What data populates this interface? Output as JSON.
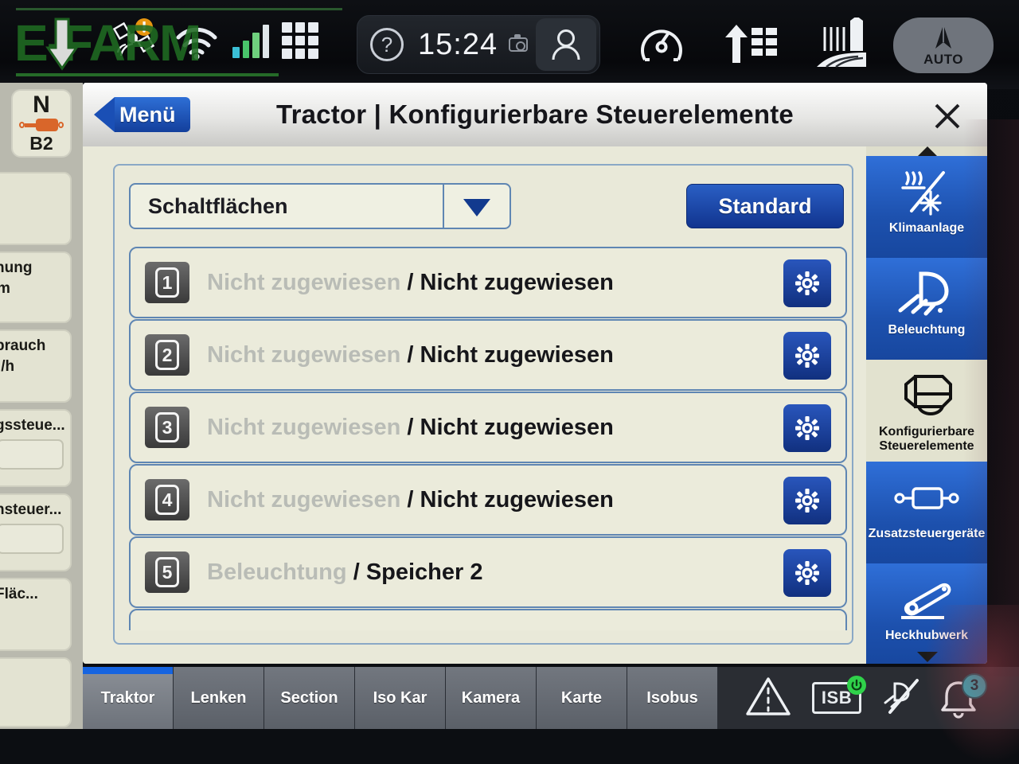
{
  "topbar": {
    "time": "15:24",
    "help_icon": "help-circle-icon",
    "camera_icon": "camera-icon",
    "user_icon": "user-icon",
    "gauge_icon": "performance-gauge-icon",
    "transfer_icon": "data-transfer-icon",
    "farm_icon": "farm-field-icon",
    "auto_label": "AUTO",
    "auto_icon": "steering-auto-icon",
    "satellite_icon": "satellite-warning-icon",
    "wifi_icon": "wifi-icon",
    "signal_icon": "signal-bars-icon",
    "apps_icon": "apps-grid-icon",
    "watermark": "E-FARM"
  },
  "left_widgets": [
    {
      "name": "gear-indicator",
      "gear": "N",
      "range": "B2"
    },
    {
      "name": "blank-widget",
      "title": "",
      "unit": ""
    },
    {
      "name": "speed-widget",
      "title": "hung",
      "unit": "m"
    },
    {
      "name": "consumption-widget",
      "title": "brauch",
      "unit": "l/h"
    },
    {
      "name": "control-widget-1",
      "title": "gssteue...",
      "unit": ""
    },
    {
      "name": "control-widget-2",
      "title": "nsteuer...",
      "unit": ""
    },
    {
      "name": "area-widget",
      "title": "Fläc...",
      "unit": ""
    },
    {
      "name": "blank-widget-2",
      "title": "",
      "unit": ""
    }
  ],
  "dialog": {
    "back_label": "Menü",
    "title": "Tractor | Konfigurierbare Steuerelemente",
    "close_icon": "close-icon",
    "selector": {
      "value": "Schaltflächen",
      "caret_icon": "chevron-down-icon"
    },
    "standard_button": "Standard",
    "rows": [
      {
        "number": "1",
        "assigned": "Nicht zugewiesen",
        "target": "Nicht zugewiesen",
        "separator": "/",
        "gear_icon": "gear-icon"
      },
      {
        "number": "2",
        "assigned": "Nicht zugewiesen",
        "target": "Nicht zugewiesen",
        "separator": "/",
        "gear_icon": "gear-icon"
      },
      {
        "number": "3",
        "assigned": "Nicht zugewiesen",
        "target": "Nicht zugewiesen",
        "separator": "/",
        "gear_icon": "gear-icon"
      },
      {
        "number": "4",
        "assigned": "Nicht zugewiesen",
        "target": "Nicht zugewiesen",
        "separator": "/",
        "gear_icon": "gear-icon"
      },
      {
        "number": "5",
        "assigned": "Beleuchtung",
        "target": "Speicher 2",
        "separator": "/",
        "gear_icon": "gear-icon"
      }
    ]
  },
  "sidebar": {
    "scroll_up_icon": "caret-up-icon",
    "scroll_down_icon": "caret-down-icon",
    "items": [
      {
        "label": "Klimaanlage",
        "icon": "climate-control-icon",
        "state": "blue"
      },
      {
        "label": "Beleuchtung",
        "icon": "headlight-icon",
        "state": "blue"
      },
      {
        "label": "Konfigurierbare Steuerelemente",
        "icon": "configurable-controls-icon",
        "state": "active"
      },
      {
        "label": "Zusatzsteuergeräte",
        "icon": "hydraulic-cylinder-icon",
        "state": "blue"
      },
      {
        "label": "Heckhubwerk",
        "icon": "rear-linkage-icon",
        "state": "blue"
      }
    ]
  },
  "tabbar": {
    "tabs": [
      {
        "label": "Traktor",
        "active": true
      },
      {
        "label": "Lenken",
        "active": false
      },
      {
        "label": "Section",
        "active": false
      },
      {
        "label": "Iso Kar",
        "active": false
      },
      {
        "label": "Kamera",
        "active": false
      },
      {
        "label": "Karte",
        "active": false
      },
      {
        "label": "Isobus",
        "active": false
      }
    ],
    "status": {
      "lane_warning_icon": "lane-guidance-warning-icon",
      "isb_label": "ISB",
      "isb_icon": "isb-power-icon",
      "lamp_off_icon": "lamp-disabled-icon",
      "bell_icon": "notification-bell-icon",
      "bell_count": "3"
    }
  },
  "colors": {
    "accent_blue": "#1d51ae",
    "panel_cream": "#e9e9d9",
    "row_border": "#5f86b3",
    "tab_active": "#1664e0",
    "badge_teal": "#2fb7c4"
  }
}
